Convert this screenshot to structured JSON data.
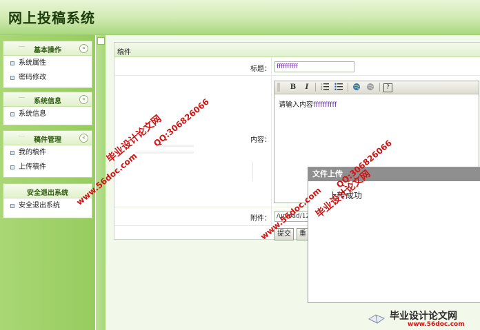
{
  "header": {
    "title": "网上投稿系统"
  },
  "sidebar": {
    "sections": [
      {
        "title": "基本操作",
        "items": [
          "系统属性",
          "密码修改"
        ]
      },
      {
        "title": "系统信息",
        "items": [
          "系统信息"
        ]
      },
      {
        "title": "稿件管理",
        "items": [
          "我的稿件",
          "上传稿件"
        ]
      },
      {
        "title": "安全退出系统",
        "items": [
          "安全退出系统"
        ]
      }
    ],
    "collapse_glyph": "«"
  },
  "form": {
    "panel_title": "稿件",
    "title_label": "标题：",
    "title_value": "ffffffffff",
    "content_label": "内容：",
    "content_prefix": "请输入内容",
    "content_value": "ffffffffff",
    "attachment_label": "附件：",
    "attachment_value": "/upload/12",
    "submit_label": "提交",
    "reset_label": "重"
  },
  "editor_toolbar": [
    "B",
    "I",
    "ordered-list-icon",
    "unordered-list-icon",
    "link-icon",
    "unlink-icon",
    "help-icon"
  ],
  "popup": {
    "title": "文件上传",
    "message": "上传成功"
  },
  "watermarks": {
    "site_name": "毕业设计论文网",
    "site_url": "www.56doc.com",
    "qq": "QQ:306826066"
  },
  "corner_logo": {
    "name": "毕业设计论文网",
    "url": "www.56doc.com"
  },
  "colors": {
    "accent": "#a9d774",
    "watermark": "#d11414"
  }
}
